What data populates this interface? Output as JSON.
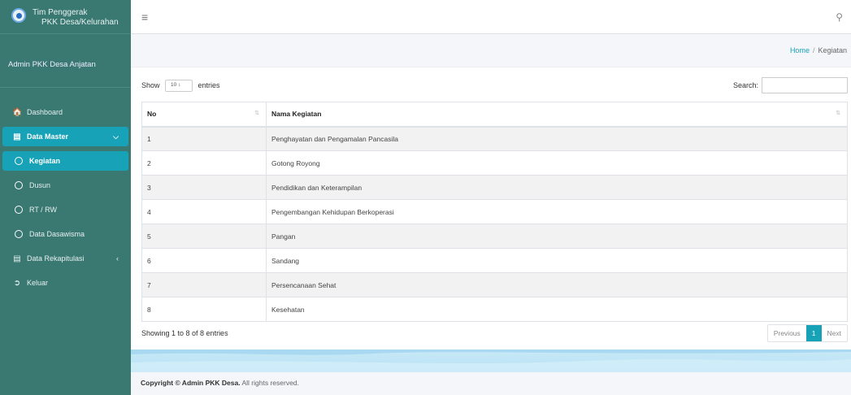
{
  "brand": {
    "line1": "Tim Penggerak",
    "line2": "PKK Desa/Kelurahan"
  },
  "user": {
    "name": "Admin PKK Desa Anjatan"
  },
  "sidebar": {
    "items": [
      {
        "label": "Dashboard",
        "icon": "home-icon"
      },
      {
        "label": "Data Master",
        "icon": "folder-icon"
      },
      {
        "label": "Kegiatan",
        "icon": "circle-icon"
      },
      {
        "label": "Dusun",
        "icon": "circle-icon"
      },
      {
        "label": "RT / RW",
        "icon": "circle-icon"
      },
      {
        "label": "Data Dasawisma",
        "icon": "circle-icon"
      },
      {
        "label": "Data Rekapitulasi",
        "icon": "folder-icon"
      },
      {
        "label": "Keluar",
        "icon": "logout-icon"
      }
    ]
  },
  "breadcrumb": {
    "home": "Home",
    "separator": "/",
    "current": "Kegiatan"
  },
  "table_controls": {
    "show_label": "Show",
    "length_value": "10",
    "entries_label": "entries",
    "search_label": "Search:",
    "search_value": ""
  },
  "table": {
    "headers": [
      "No",
      "Nama Kegiatan"
    ],
    "rows": [
      [
        "1",
        "Penghayatan dan Pengamalan Pancasila"
      ],
      [
        "2",
        "Gotong Royong"
      ],
      [
        "3",
        "Pendidikan dan Keterampilan"
      ],
      [
        "4",
        "Pengembangan Kehidupan Berkoperasi"
      ],
      [
        "5",
        "Pangan"
      ],
      [
        "6",
        "Sandang"
      ],
      [
        "7",
        "Persencanaan Sehat"
      ],
      [
        "8",
        "Kesehatan"
      ]
    ]
  },
  "table_info": "Showing 1 to 8 of 8 entries",
  "pagination": {
    "previous": "Previous",
    "current": "1",
    "next": "Next"
  },
  "footer": {
    "strong": "Copyright © Admin PKK Desa.",
    "rest": " All rights reserved."
  },
  "colors": {
    "sidebar": "#3a7872",
    "accent": "#17a2b8"
  }
}
